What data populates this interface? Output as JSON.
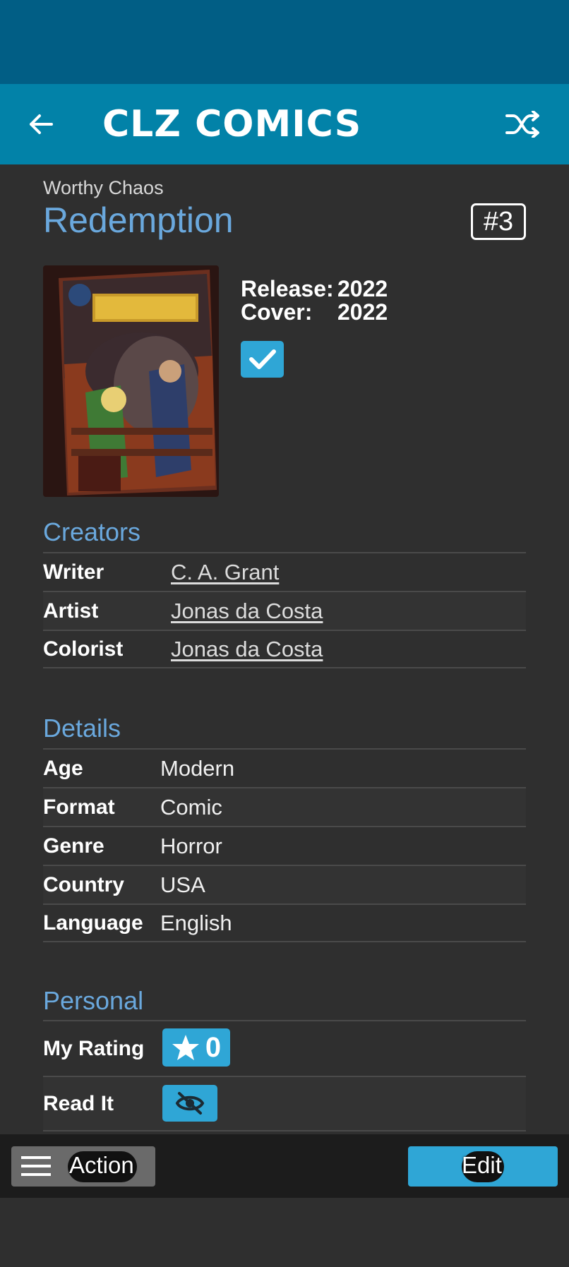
{
  "app": {
    "logo_text": "CLZ COMICS",
    "back_icon": "arrow-left-icon",
    "shuffle_icon": "shuffle-icon"
  },
  "comic": {
    "series": "Worthy Chaos",
    "title": "Redemption",
    "issue": "#3",
    "cover_alt": "Redemption Chapter 3 comic cover",
    "dates": [
      {
        "label": "Release:",
        "value": "2022"
      },
      {
        "label": "Cover:",
        "value": "2022"
      }
    ],
    "owned_checked": true
  },
  "creators": {
    "title": "Creators",
    "rows": [
      {
        "role": "Writer",
        "name": "C. A. Grant"
      },
      {
        "role": "Artist",
        "name": "Jonas da Costa"
      },
      {
        "role": "Colorist",
        "name": "Jonas da Costa"
      }
    ]
  },
  "details": {
    "title": "Details",
    "rows": [
      {
        "label": "Age",
        "value": "Modern"
      },
      {
        "label": "Format",
        "value": "Comic"
      },
      {
        "label": "Genre",
        "value": "Horror"
      },
      {
        "label": "Country",
        "value": "USA"
      },
      {
        "label": "Language",
        "value": "English"
      }
    ]
  },
  "personal": {
    "title": "Personal",
    "rating_label": "My Rating",
    "rating_value": "0",
    "read_label": "Read It"
  },
  "bottom_bar": {
    "action_label": "Action",
    "edit_label": "Edit"
  },
  "colors": {
    "status_bar": "#015e85",
    "app_bar": "#0282a8",
    "accent": "#2fa6d6",
    "section_title": "#6aa8dd",
    "background": "#2f2f2f"
  }
}
